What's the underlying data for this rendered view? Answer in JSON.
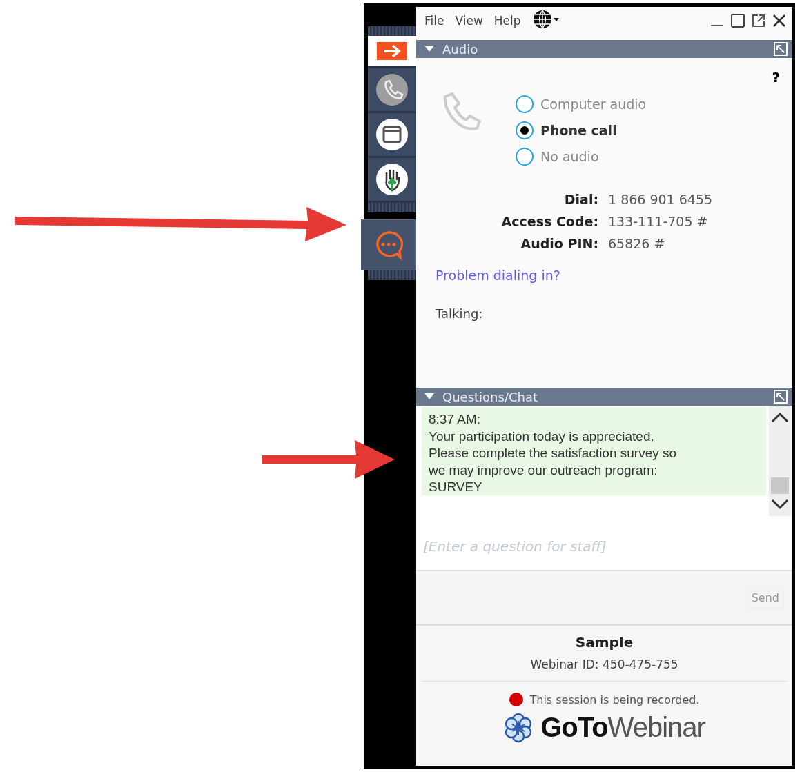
{
  "menu": [
    "File",
    "View",
    "Help"
  ],
  "sidebar": {
    "items": [
      {
        "kind": "arrow",
        "selected": false
      },
      {
        "kind": "phone",
        "selected": false
      },
      {
        "kind": "window",
        "selected": false
      },
      {
        "kind": "hand",
        "selected": false
      },
      {
        "kind": "chat",
        "selected": true
      }
    ]
  },
  "audio": {
    "title": "Audio",
    "help": "?",
    "options": [
      {
        "label": "Computer audio",
        "selected": false
      },
      {
        "label": "Phone call",
        "selected": true
      },
      {
        "label": "No audio",
        "selected": false
      }
    ],
    "details": [
      {
        "label": "Dial:",
        "value": "1 866 901 6455"
      },
      {
        "label": "Access Code:",
        "value": "133-111-705 #"
      },
      {
        "label": "Audio PIN:",
        "value": "65826 #"
      }
    ],
    "link": "Problem dialing in?",
    "talking": "Talking:"
  },
  "chat": {
    "title": "Questions/Chat",
    "message": {
      "time": "8:37 AM:",
      "lines": [
        "Your participation today is appreciated.",
        "Please complete the satisfaction survey so",
        "we may improve our outreach program:",
        "SURVEY"
      ]
    },
    "placeholder": "[Enter a question for staff]",
    "send": {
      "label": "Send",
      "disabled": true
    }
  },
  "footer": {
    "title": "Sample",
    "webinar_id": "Webinar ID: 450-475-755",
    "recording": "This session is being recorded.",
    "logo": "**GoTo**Webinar"
  }
}
